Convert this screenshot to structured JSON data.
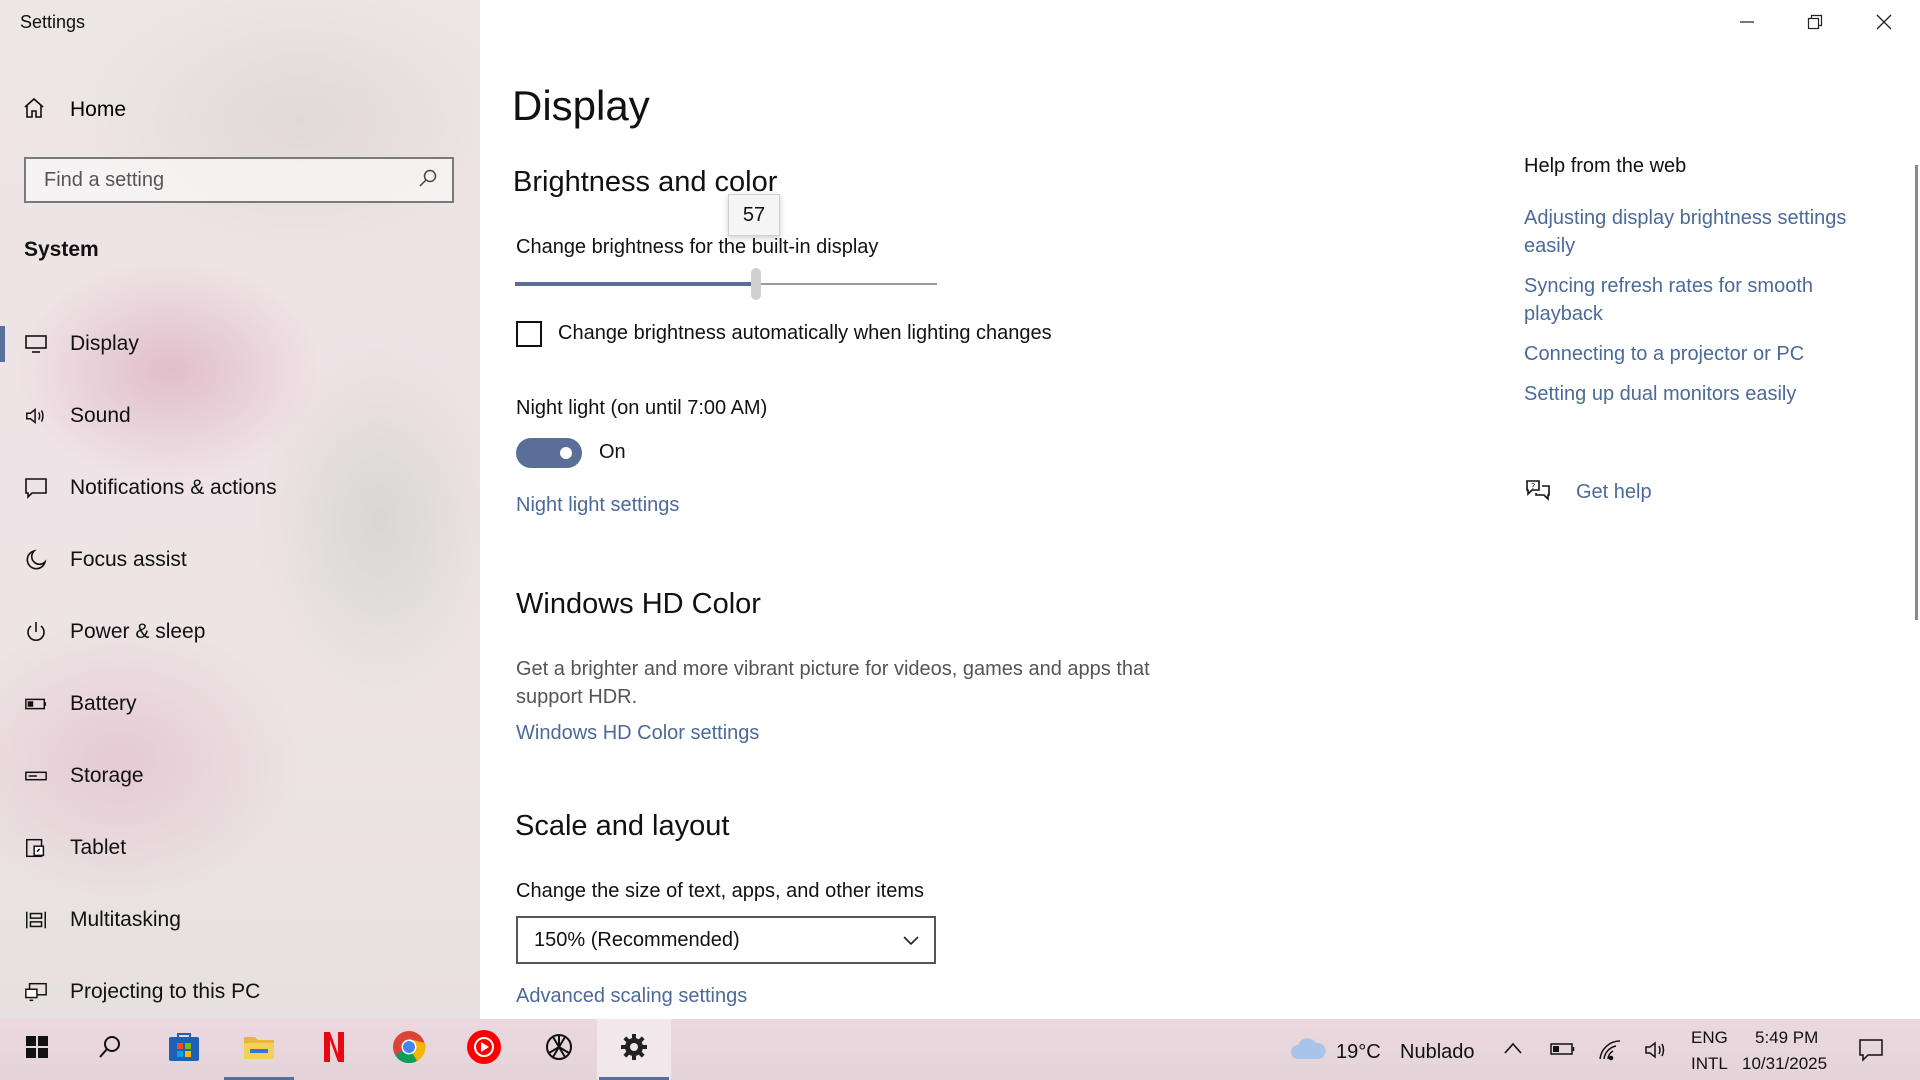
{
  "window": {
    "title": "Settings",
    "controls": [
      "minimize-icon",
      "restore-icon",
      "close-icon"
    ]
  },
  "sidebar": {
    "home_label": "Home",
    "search_placeholder": "Find a setting",
    "section": "System",
    "items": [
      {
        "label": "Display",
        "icon": "display-icon",
        "active": true
      },
      {
        "label": "Sound",
        "icon": "speaker-icon"
      },
      {
        "label": "Notifications & actions",
        "icon": "notifications-icon"
      },
      {
        "label": "Focus assist",
        "icon": "moon-icon"
      },
      {
        "label": "Power & sleep",
        "icon": "power-icon"
      },
      {
        "label": "Battery",
        "icon": "battery-icon"
      },
      {
        "label": "Storage",
        "icon": "storage-icon"
      },
      {
        "label": "Tablet",
        "icon": "tablet-icon"
      },
      {
        "label": "Multitasking",
        "icon": "multitasking-icon"
      },
      {
        "label": "Projecting to this PC",
        "icon": "projecting-icon"
      }
    ]
  },
  "main": {
    "title": "Display",
    "brightness": {
      "heading": "Brightness and color",
      "label": "Change brightness for the built-in display",
      "value": 57,
      "tooltip": "57",
      "auto_label": "Change brightness automatically when lighting changes",
      "auto_checked": false
    },
    "night_light": {
      "label": "Night light (on until 7:00 AM)",
      "state": "On",
      "enabled": true,
      "settings_link": "Night light settings"
    },
    "hd_color": {
      "heading": "Windows HD Color",
      "description_line1": "Get a brighter and more vibrant picture for videos, games and apps that",
      "description_line2": "support HDR.",
      "settings_link": "Windows HD Color settings"
    },
    "scale": {
      "heading": "Scale and layout",
      "label": "Change the size of text, apps, and other items",
      "selected": "150% (Recommended)",
      "advanced_link": "Advanced scaling settings"
    }
  },
  "help": {
    "title": "Help from the web",
    "links": [
      "Adjusting display brightness settings easily",
      "Syncing refresh rates for smooth playback",
      "Connecting to a projector or PC",
      "Setting up dual monitors easily"
    ],
    "get_help": "Get help"
  },
  "taskbar": {
    "apps": [
      "start-icon",
      "search-icon",
      "store-icon",
      "file-explorer-icon",
      "netflix-icon",
      "chrome-icon",
      "youtube-music-icon",
      "chatgpt-icon",
      "settings-gear-icon"
    ],
    "weather": {
      "temp": "19°C",
      "condition": "Nublado"
    },
    "language": {
      "line1": "ENG",
      "line2": "INTL"
    },
    "clock": {
      "time": "5:49 PM",
      "date": "10/31/2025"
    }
  },
  "colors": {
    "accent": "#5a6f98",
    "link": "#4c6a99"
  }
}
